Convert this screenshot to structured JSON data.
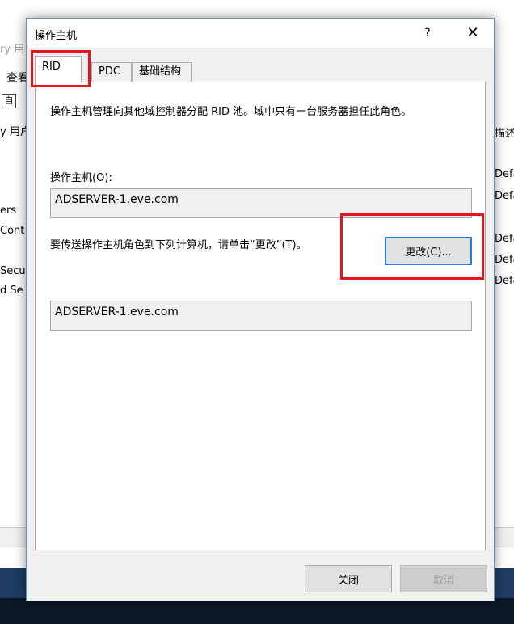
{
  "background": {
    "titlebar_fragment": "ry 用",
    "menu_fragment": "查看",
    "toolbar_icon_glyph": "自",
    "left_list": [
      "y 用户",
      "ers",
      "Cont",
      "Secur",
      "d Se"
    ],
    "right_header": "描述",
    "right_list": [
      "Defa",
      "Defa",
      "Defa",
      "Defa",
      "Defa"
    ]
  },
  "dialog": {
    "title": "操作主机",
    "help_label": "?",
    "close_label": "✕",
    "tabs": [
      {
        "label": "RID",
        "active": true
      },
      {
        "label": "PDC",
        "active": false
      },
      {
        "label": "基础结构",
        "active": false
      }
    ],
    "description": "操作主机管理向其他域控制器分配 RID 池。域中只有一台服务器担任此角色。",
    "owner_label": "操作主机(O):",
    "owner_value": "ADSERVER-1.eve.com",
    "transfer_text": "要传送操作主机角色到下列计算机，请单击“更改”(T)。",
    "change_button": "更改(C)...",
    "target_value": "ADSERVER-1.eve.com",
    "close_button": "关闭",
    "cancel_button": "取消"
  },
  "colors": {
    "highlight_red": "#e8141c",
    "focus_blue": "#2a7ad8",
    "dialog_bg": "#f0f0f0"
  }
}
